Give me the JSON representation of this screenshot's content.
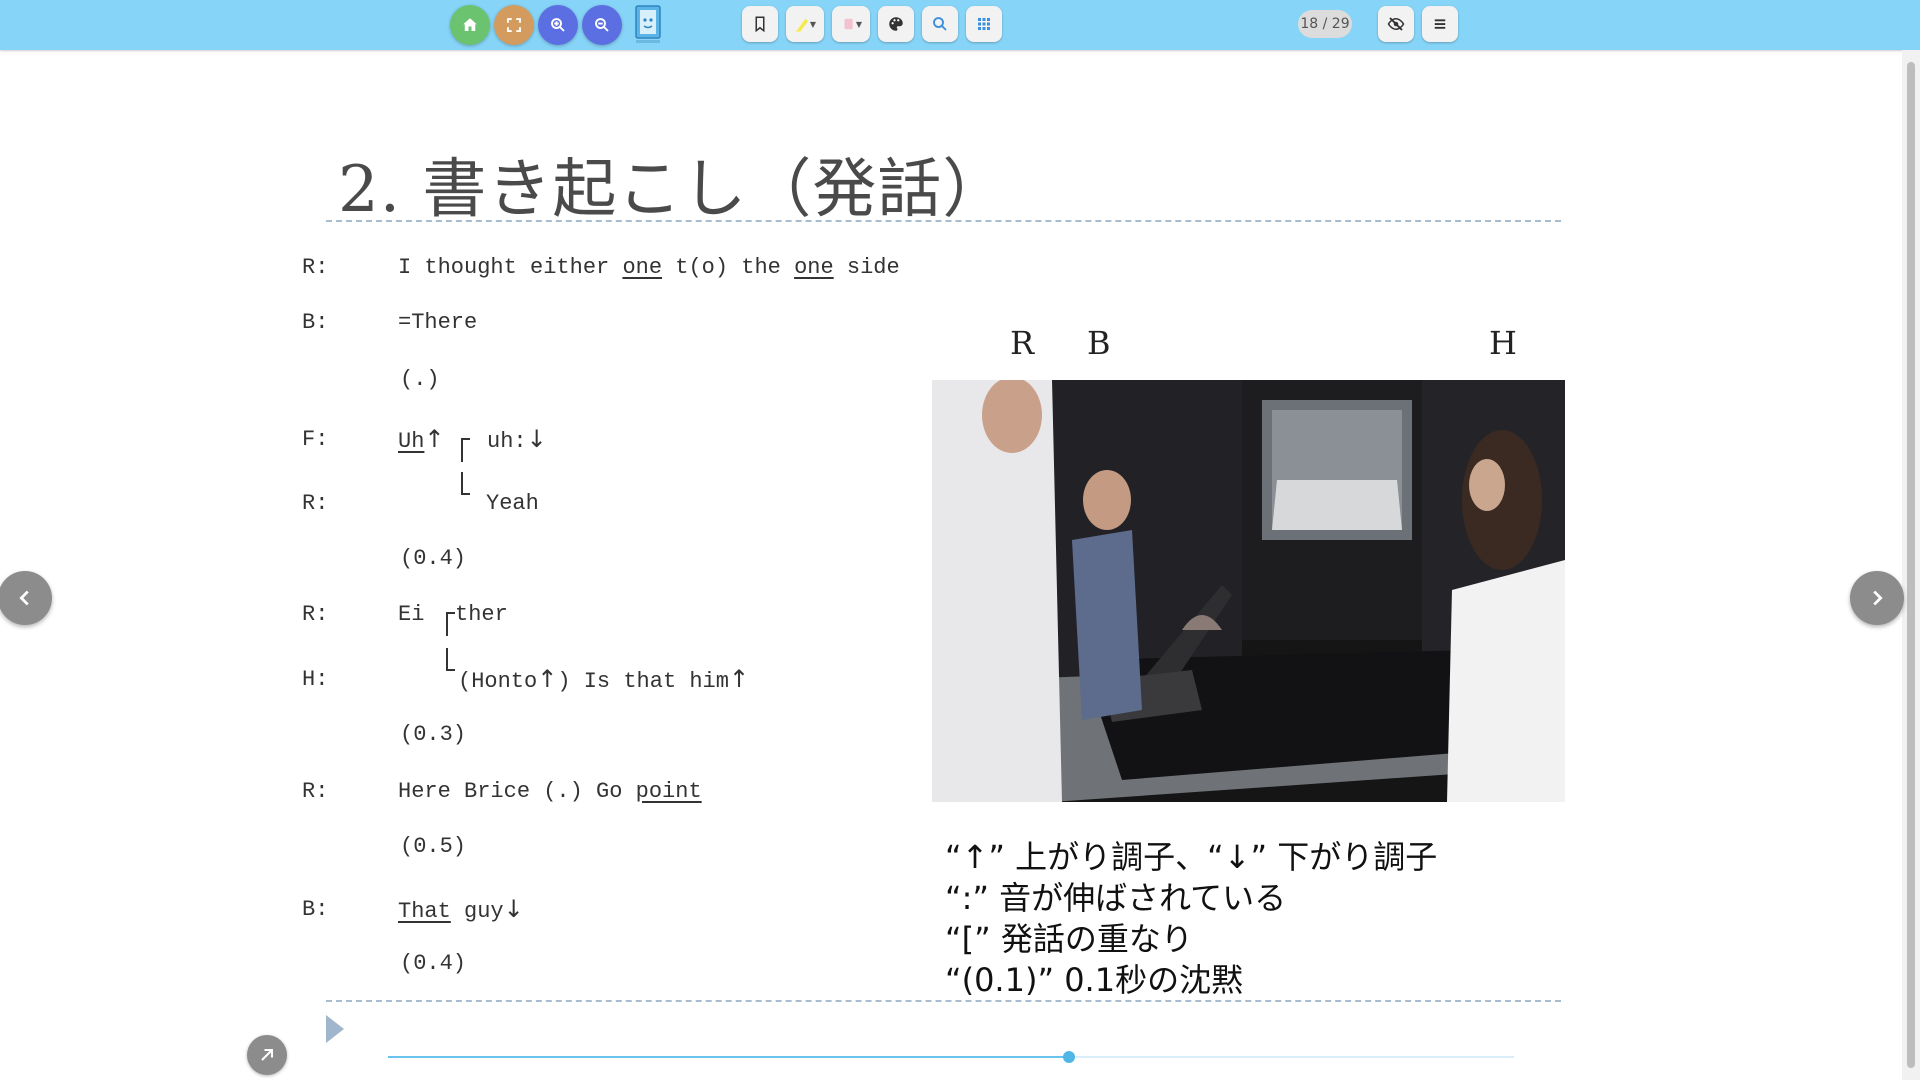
{
  "toolbar": {
    "page_indicator": "18 / 29",
    "colors": {
      "bar": "#86d4f7",
      "home": "#6cc36f",
      "fullscreen": "#d39b5e",
      "zoom": "#5b6fe3"
    }
  },
  "slide": {
    "title": "2. 書き起こし（発話）",
    "transcript": {
      "l1_spk": "R:",
      "l1_a": "I thought either ",
      "l1_b": "one",
      "l1_c": " t(o) the ",
      "l1_d": "one",
      "l1_e": " side",
      "l2_spk": "B:",
      "l2": "=There",
      "l3": "(.)",
      "l4_spk": "F:",
      "l4_a": "Uh",
      "l4_arrow": "↑",
      "l4_b": "uh:",
      "l4_arrow2": "↓",
      "l5_spk": "R:",
      "l5": "Yeah",
      "l6": "(0.4)",
      "l7_spk": "R:",
      "l7_a": "Ei",
      "l7_b": "ther",
      "l8_spk": "H:",
      "l8_a": "(Honto",
      "l8_arrow": "↑",
      "l8_b": ") Is that him",
      "l8_arrow2": "↑",
      "l9": "(0.3)",
      "l10_spk": "R:",
      "l10_a": "Here Brice (.) Go ",
      "l10_b": "point",
      "l11": "(0.5)",
      "l12_spk": "B:",
      "l12_a": "That",
      "l12_b": " guy",
      "l12_arrow": "↓",
      "l13": "(0.4)"
    },
    "participants": {
      "r": "R",
      "b": "B",
      "h": "H"
    },
    "legend": [
      "“↑”  上がり調子、“↓”  下がり調子",
      "“:”  音が伸ばされている",
      "“[”  発話の重なり",
      "“(0.1)”  0.1秒の沈黙"
    ]
  },
  "player": {
    "progress": 0.605
  }
}
